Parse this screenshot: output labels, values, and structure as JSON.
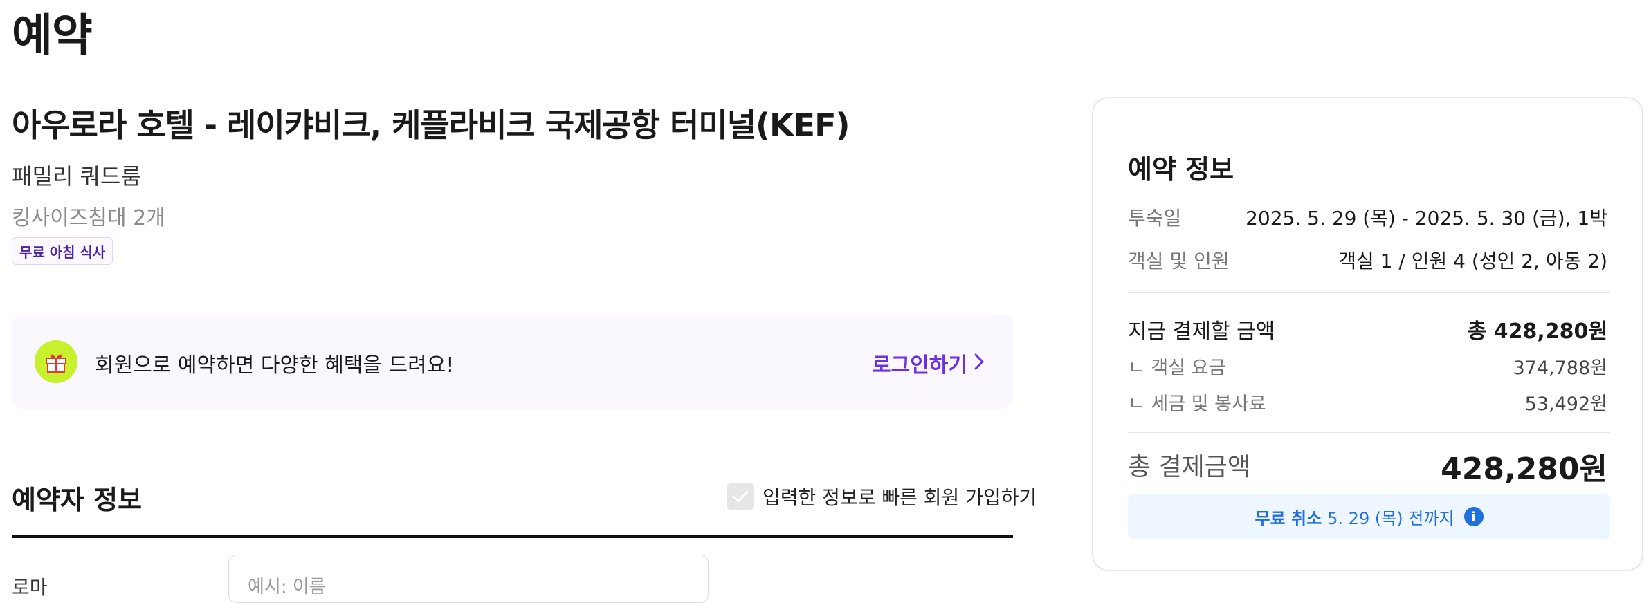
{
  "page": {
    "title": "예약"
  },
  "hotel": {
    "name": "아우로라 호텔 - 레이캬비크, 케플라비크 국제공항 터미널(KEF)",
    "room_type": "패밀리 쿼드룸",
    "bed_info": "킹사이즈침대 2개",
    "badge": "무료 아침 식사"
  },
  "promo": {
    "text": "회원으로 예약하면 다양한 혜택을 드려요!",
    "login_label": "로그인하기",
    "icon": "gift-icon"
  },
  "booker": {
    "section_title": "예약자 정보",
    "signup_label": "입력한 정보로 빠른 회원 가입하기",
    "name_label": "로마",
    "name_placeholder": "예시: 이름"
  },
  "summary": {
    "title": "예약 정보",
    "stay_label": "투숙일",
    "stay_value": "2025. 5. 29 (목) - 2025. 5. 30 (금), 1박",
    "guests_label": "객실 및 인원",
    "guests_value": "객실 1 / 인원 4 (성인 2, 아동 2)",
    "pay_now_label": "지금 결제할 금액",
    "pay_now_value": "총 428,280원",
    "room_fee_label": "ㄴ 객실 요금",
    "room_fee_value": "374,788원",
    "tax_label": "ㄴ 세금 및 봉사료",
    "tax_value": "53,492원",
    "total_label": "총 결제금액",
    "total_value": "428,280원",
    "cancel_strong": "무료 취소",
    "cancel_text": "5. 29 (목) 전까지"
  },
  "colors": {
    "accent_purple": "#6b30e3",
    "gift_green": "#c7f12d",
    "info_blue": "#1f6fe0",
    "promo_bg": "#faf7ff",
    "cancel_bg": "#eef6ff"
  }
}
